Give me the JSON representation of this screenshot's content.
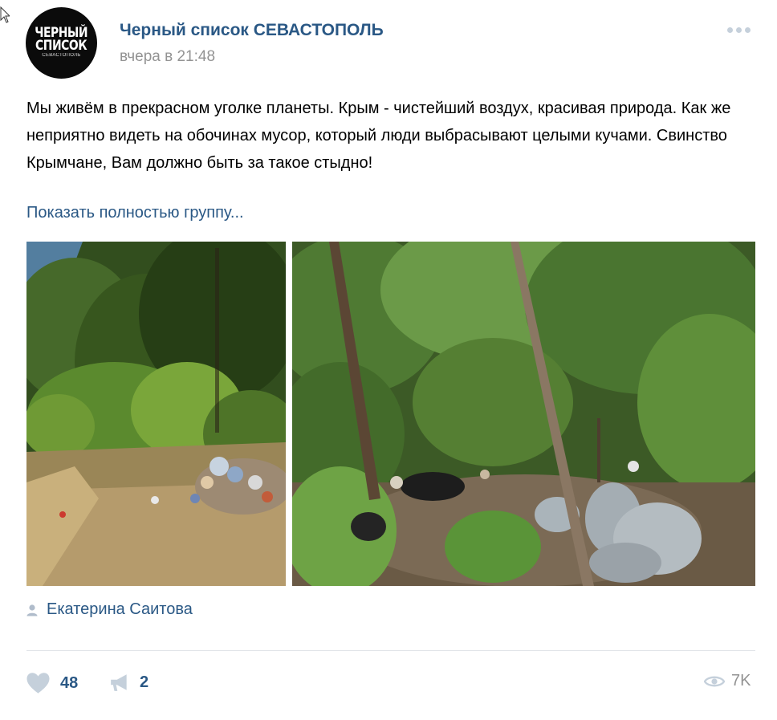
{
  "group": {
    "name": "Черный список СЕВАСТОПОЛЬ",
    "avatar": {
      "line1": "ЧЕРНЫЙ",
      "line2": "СПИСОК",
      "line3": "СЕВАСТОПОЛЬ"
    }
  },
  "post": {
    "time": "вчера в 21:48",
    "text": "Мы живём в прекрасном уголке планеты. Крым - чистейший воздух, красивая природа. Как же неприятно видеть на обочинах мусор, который люди выбрасывают целыми кучами. Свинство Крымчане, Вам должно быть за такое стыдно!",
    "show_more": "Показать полностью группу...",
    "author": "Екатерина Саитова"
  },
  "footer": {
    "likes": "48",
    "shares": "2",
    "views": "7K"
  },
  "icons": {
    "more": "more-dots-icon",
    "author": "person-icon",
    "like": "heart-icon",
    "share": "megaphone-icon",
    "views": "eye-icon"
  },
  "colors": {
    "link": "#2a5885",
    "muted": "#939393",
    "icon": "#c5d0db"
  }
}
